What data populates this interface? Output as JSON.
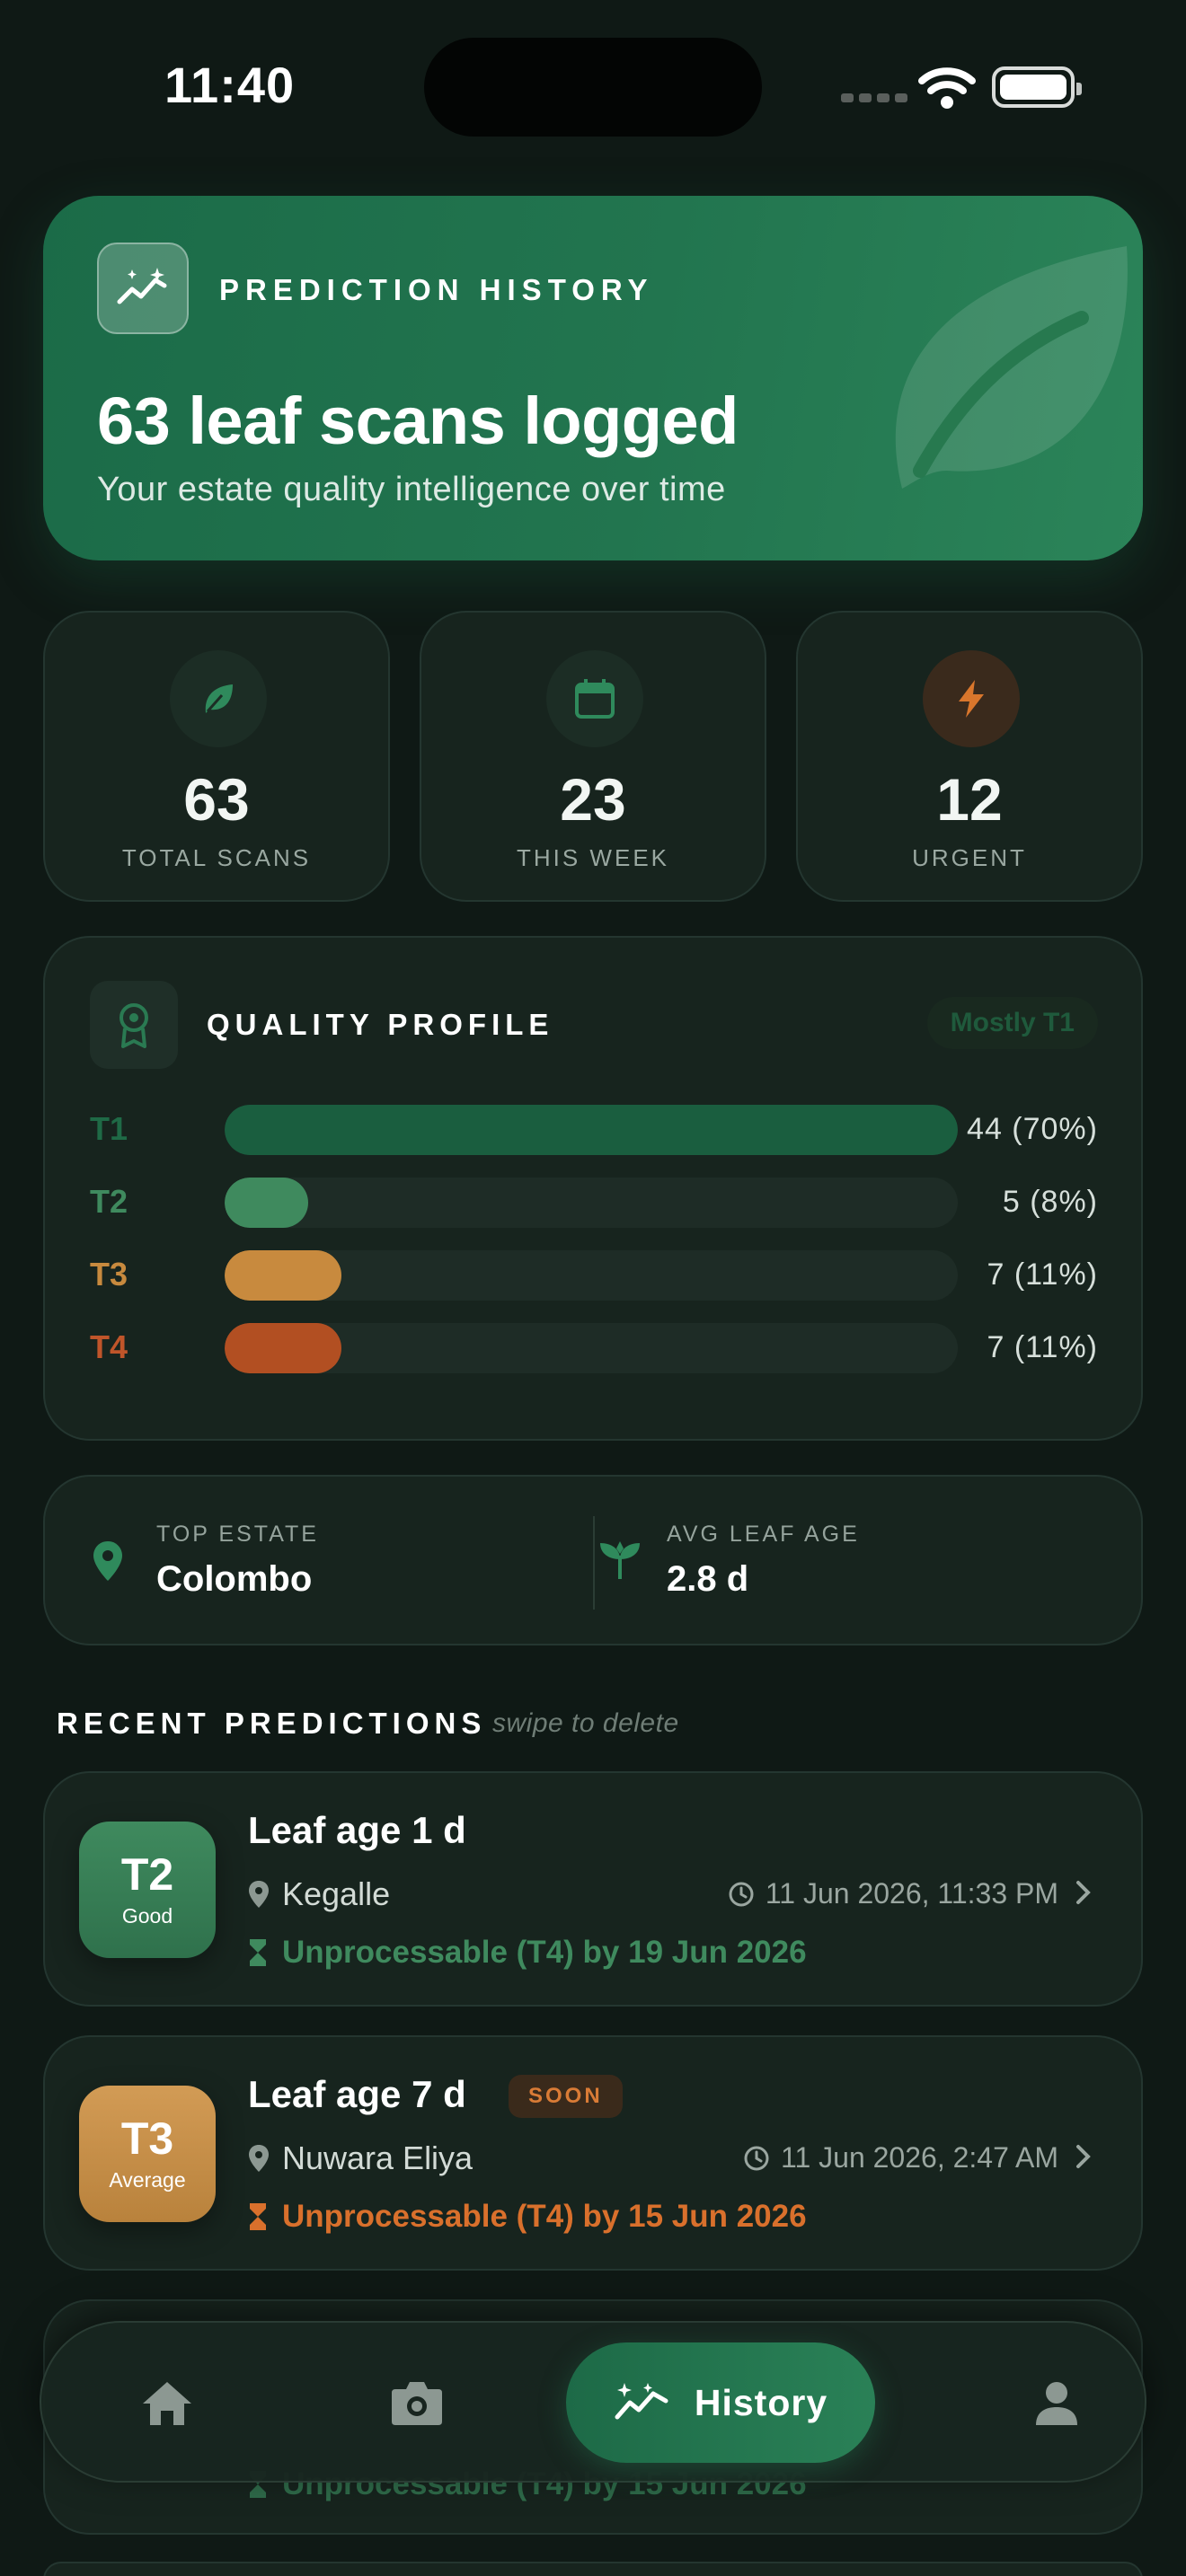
{
  "status_bar": {
    "time": "11:40"
  },
  "hero": {
    "kicker": "PREDICTION HISTORY",
    "title": "63 leaf scans logged",
    "subtitle": "Your estate quality intelligence over time",
    "icon": "trend-sparkle-icon"
  },
  "stats": [
    {
      "value": "63",
      "label": "TOTAL SCANS",
      "icon": "leaf-icon",
      "color": "#2f8a5c"
    },
    {
      "value": "23",
      "label": "THIS WEEK",
      "icon": "calendar-icon",
      "color": "#2f8a5c"
    },
    {
      "value": "12",
      "label": "URGENT",
      "icon": "bolt-icon",
      "color": "#d9762c"
    }
  ],
  "quality_profile": {
    "title": "QUALITY PROFILE",
    "badge": "Mostly T1",
    "tiers": [
      {
        "label": "T1",
        "value": "44 (70%)",
        "fraction": 1.0,
        "color": "#1a5e3f"
      },
      {
        "label": "T2",
        "value": "5 (8%)",
        "fraction": 0.114,
        "color": "#3f8a5e"
      },
      {
        "label": "T3",
        "value": "7 (11%)",
        "fraction": 0.159,
        "color": "#c88a3e"
      },
      {
        "label": "T4",
        "value": "7 (11%)",
        "fraction": 0.159,
        "color": "#b24f22"
      }
    ]
  },
  "estate": {
    "top_estate_label": "TOP ESTATE",
    "top_estate_value": "Colombo",
    "avg_age_label": "AVG LEAF AGE",
    "avg_age_value": "2.8 d"
  },
  "recent": {
    "title": "RECENT PREDICTIONS",
    "hint": "swipe to delete",
    "items": [
      {
        "tier": "T2",
        "quality": "Good",
        "age": "Leaf age 1 d",
        "location": "Kegalle",
        "timestamp": "11 Jun 2026, 11:33 PM",
        "unprocessable": "Unprocessable (T4) by 19 Jun 2026",
        "accent": "#3f8a5e"
      },
      {
        "tier": "T3",
        "quality": "Average",
        "age": "Leaf age 7 d",
        "tag": "SOON",
        "location": "Nuwara Eliya",
        "timestamp": "11 Jun 2026, 2:47 AM",
        "unprocessable": "Unprocessable (T4) by 15 Jun 2026",
        "accent": "#d9702c"
      },
      {
        "unprocessable": "Unprocessable (T4) by 15 Jun 2026"
      }
    ]
  },
  "nav": {
    "items": [
      "home-icon",
      "camera-icon",
      "History",
      "profile-icon"
    ],
    "active_label": "History"
  }
}
